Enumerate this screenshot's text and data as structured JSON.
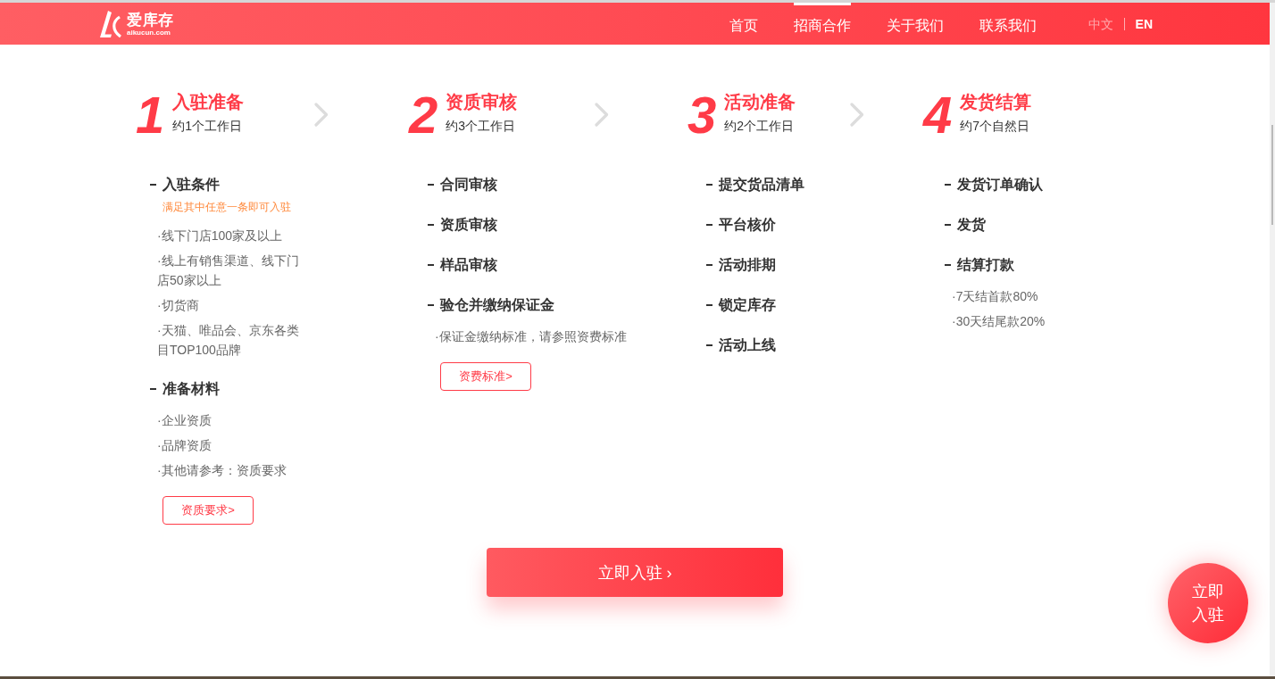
{
  "header": {
    "logo": {
      "name": "爱库存",
      "domain": "aikucun.com"
    },
    "nav": [
      {
        "label": "首页",
        "selected": false
      },
      {
        "label": "招商合作",
        "selected": true
      },
      {
        "label": "关于我们",
        "selected": false
      },
      {
        "label": "联系我们",
        "selected": false
      }
    ],
    "languages": [
      {
        "label": "中文",
        "dimmed": true
      },
      {
        "label": "EN",
        "dimmed": false
      }
    ]
  },
  "steps": [
    {
      "number": "1",
      "title": "入驻准备",
      "duration": "约1个工作日",
      "groups": [
        {
          "heading": "入驻条件",
          "note": "满足其中任意一条即可入驻",
          "bullets": [
            "·线下门店100家及以上",
            "·线上有销售渠道、线下门店50家以上",
            "·切货商",
            "·天猫、唯品会、京东各类目TOP100品牌"
          ]
        },
        {
          "heading": "准备材料",
          "bullets": [
            "·企业资质",
            "·品牌资质",
            "·其他请参考：资质要求"
          ],
          "button": "资质要求>"
        }
      ]
    },
    {
      "number": "2",
      "title": "资质审核",
      "duration": "约3个工作日",
      "groups": [
        {
          "heading": "合同审核"
        },
        {
          "heading": "资质审核"
        },
        {
          "heading": "样品审核"
        },
        {
          "heading": "验仓并缴纳保证金",
          "bullets": [
            "·保证金缴纳标准，请参照资费标准"
          ],
          "button": "资费标准>"
        }
      ]
    },
    {
      "number": "3",
      "title": "活动准备",
      "duration": "约2个工作日",
      "groups": [
        {
          "heading": "提交货品清单"
        },
        {
          "heading": "平台核价"
        },
        {
          "heading": "活动排期"
        },
        {
          "heading": "锁定库存"
        },
        {
          "heading": "活动上线"
        }
      ]
    },
    {
      "number": "4",
      "title": "发货结算",
      "duration": "约7个自然日",
      "groups": [
        {
          "heading": "发货订单确认"
        },
        {
          "heading": "发货"
        },
        {
          "heading": "结算打款",
          "bullets": [
            "·7天结首款80%",
            "·30天结尾款20%"
          ]
        }
      ]
    }
  ],
  "cta_button": "立即入驻 ›",
  "floating_button": "立即入驻"
}
